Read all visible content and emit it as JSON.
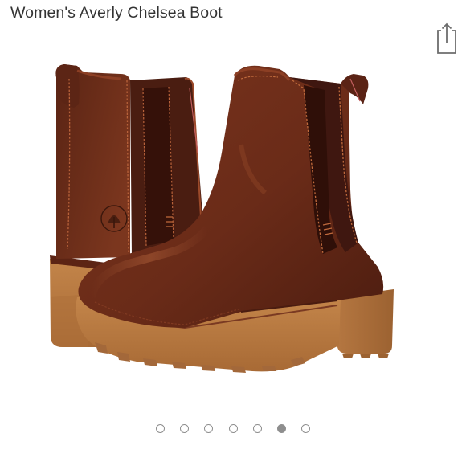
{
  "header": {
    "title": "Women's Averly Chelsea Boot",
    "share_icon": "share-icon"
  },
  "photo": {
    "subject": "boot-photo",
    "colors": {
      "leather": "#6e2e1a",
      "leather_dark": "#4a1c10",
      "leather_light": "#8c4226",
      "gore": "#3d1a12",
      "sole": "#b9793f",
      "sole_dark": "#8f5a2b",
      "stitch": "#c06a3c"
    }
  },
  "carousel": {
    "total": 7,
    "active_index": 5,
    "dot_color": "#8e8e8e"
  }
}
